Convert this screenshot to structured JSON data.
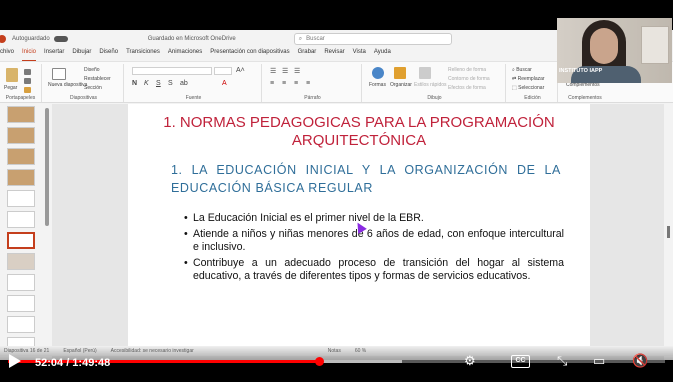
{
  "app": {
    "title_bar": {
      "autosave": "Autoguardado",
      "doc_name": "Guardado en Microsoft OneDrive",
      "search_placeholder": "Buscar"
    },
    "menu": [
      "chivo",
      "Inicio",
      "Insertar",
      "Dibujar",
      "Diseño",
      "Transiciones",
      "Animaciones",
      "Presentación con diapositivas",
      "Grabar",
      "Revisar",
      "Vista",
      "Ayuda"
    ],
    "ribbon": {
      "groups": [
        "Portapapeles",
        "Diapositivas",
        "Fuente",
        "Párrafo",
        "Dibujo",
        "Edición",
        "Complementos"
      ],
      "paste": "Pegar",
      "new_slide": "Nueva diapositiva",
      "layout": "Diseño",
      "reset": "Restablecer",
      "section": "Sección",
      "shapes": "Formas",
      "arrange": "Organizar",
      "quick_styles": "Estilos rápidos",
      "shape_fill": "Relleno de forma",
      "shape_outline": "Contorno de forma",
      "shape_effects": "Efectos de forma",
      "find": "Buscar",
      "replace": "Reemplazar",
      "select": "Seleccionar",
      "addins": "Complementos"
    },
    "thumbnails_count": 12,
    "selected_thumbnail": 6,
    "status_bar": [
      "Diapositiva 16 de 21",
      "Español (Perú)",
      "Accesibilidad: se necesario investigar",
      "Notas",
      "60 %"
    ]
  },
  "slide": {
    "title": "1. NORMAS PEDAGOGICAS PARA LA PROGRAMACIÓN ARQUITECTÓNICA",
    "subtitle": "1. LA EDUCACIÓN INICIAL Y LA ORGANIZACIÓN DE LA EDUCACIÓN BÁSICA REGULAR",
    "bullets": [
      "La Educación Inicial es el primer nivel de la EBR.",
      "Atiende a niños y niñas menores de 6 años de edad, con enfoque intercultural e inclusivo.",
      "Contribuye a un adecuado proceso de transición del hogar al sistema educativo, a través de diferentes tipos y formas de servicios educativos."
    ]
  },
  "webcam": {
    "label": "INSTITUTO IAPP"
  },
  "player": {
    "time": "52:04 / 1:49:48",
    "progress": 0.474,
    "loaded": 0.6,
    "colors": {
      "played": "#ff0000"
    },
    "icons": [
      "play-icon",
      "settings-icon",
      "cc-icon",
      "miniplayer-icon",
      "theater-icon",
      "fullscreen-icon",
      "mute-icon"
    ],
    "cc_label": "CC"
  }
}
